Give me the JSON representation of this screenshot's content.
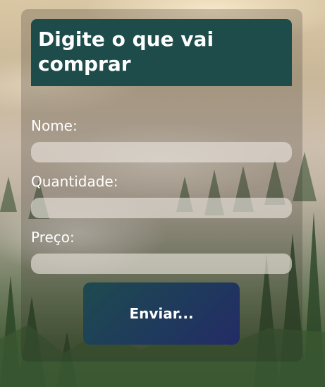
{
  "form": {
    "title": "Digite o que vai comprar",
    "fields": [
      {
        "label": "Nome:",
        "value": "",
        "placeholder": ""
      },
      {
        "label": "Quantidade:",
        "value": "",
        "placeholder": ""
      },
      {
        "label": "Preço:",
        "value": "",
        "placeholder": ""
      }
    ],
    "submit_label": "Enviar..."
  },
  "colors": {
    "title_background": "#1d4c4a",
    "button_gradient_start": "#1e4a50",
    "button_gradient_end": "#232b66"
  },
  "background": {
    "description_icon": "forest-fog-photo"
  }
}
